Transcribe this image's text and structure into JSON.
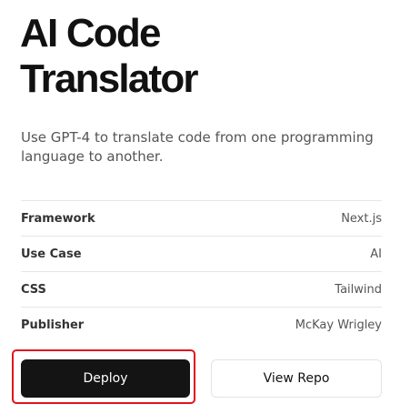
{
  "header": {
    "title_line1": "AI Code",
    "title_line2": "Translator"
  },
  "description": "Use GPT-4 to translate code from one programming language to another.",
  "details": [
    {
      "key": "Framework",
      "value": "Next.js"
    },
    {
      "key": "Use Case",
      "value": "AI"
    },
    {
      "key": "CSS",
      "value": "Tailwind"
    },
    {
      "key": "Publisher",
      "value": "McKay Wrigley"
    }
  ],
  "actions": {
    "deploy_label": "Deploy",
    "view_repo_label": "View Repo"
  },
  "colors": {
    "highlight": "#e0141e",
    "primary_button": "#141414"
  }
}
